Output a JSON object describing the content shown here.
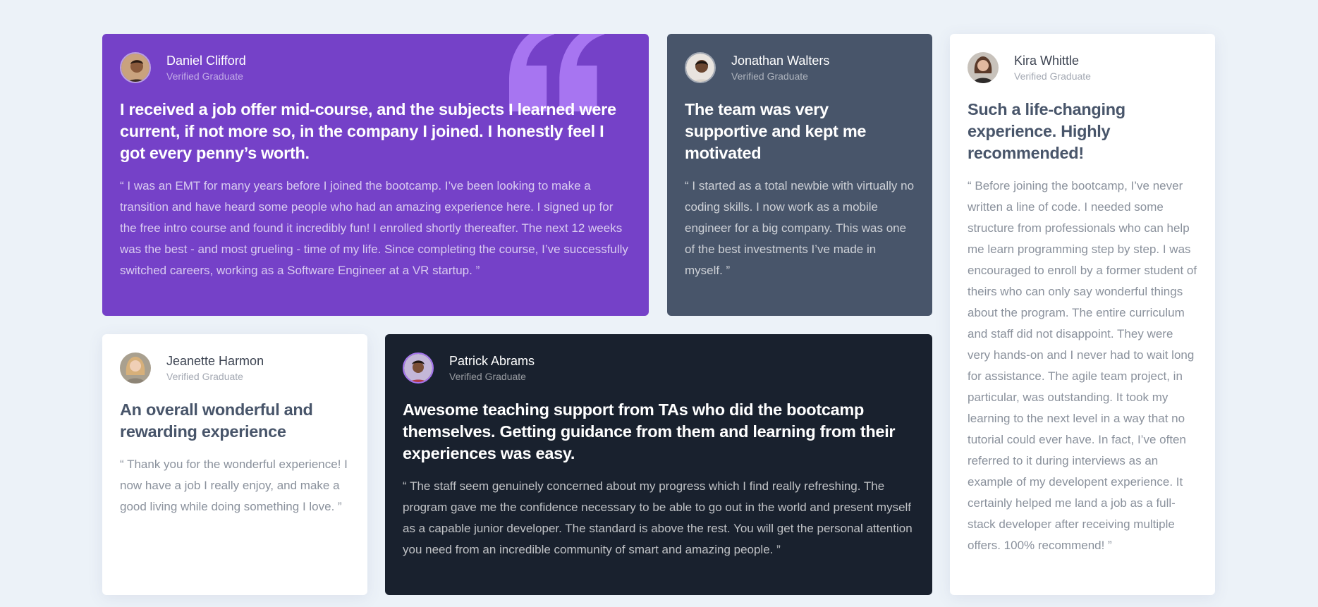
{
  "colors": {
    "page_bg": "#ecf2f8",
    "violet": "#7541c8",
    "grey_blue": "#48556a",
    "white": "#ffffff",
    "dark_navy": "#19212e",
    "quote_mark": "#a775f1"
  },
  "testimonials": [
    {
      "name": "Daniel Clifford",
      "role": "Verified Graduate",
      "headline": "I received a job offer mid-course, and the subjects I learned were current, if not more so, in the company I joined. I honestly feel I got every penny’s worth.",
      "quote": "“ I was an EMT for many years before I joined the bootcamp. I’ve been looking to make a transition and have heard some people who had an amazing experience here. I signed up for the free intro course and found it incredibly fun! I enrolled shortly thereafter. The next 12 weeks was the best - and most grueling - time of my life. Since completing the course, I’ve successfully switched careers, working as a Software Engineer at a VR startup. ”",
      "avatar_icon": "avatar-photo"
    },
    {
      "name": "Jonathan Walters",
      "role": "Verified Graduate",
      "headline": "The team was very supportive and kept me motivated",
      "quote": "“ I started as a total newbie with virtually no coding skills. I now work as a mobile engineer for a big company. This was one of the best investments I’ve made in myself. ”",
      "avatar_icon": "avatar-photo"
    },
    {
      "name": "Kira Whittle",
      "role": "Verified Graduate",
      "headline": "Such a life-changing experience. Highly recommended!",
      "quote": "“ Before joining the bootcamp, I’ve never written a line of code. I needed some structure from professionals who can help me learn programming step by step. I was encouraged to enroll by a former student of theirs who can only say wonderful things about the program. The entire curriculum and staff did not disappoint. They were very hands-on and I never had to wait long for assistance. The agile team project, in particular, was outstanding. It took my learning to the next level in a way that no tutorial could ever have. In fact, I’ve often referred to it during interviews as an example of my developent experience. It certainly helped me land a job as a full-stack developer after receiving multiple offers. 100% recommend! ”",
      "avatar_icon": "avatar-photo"
    },
    {
      "name": "Jeanette Harmon",
      "role": "Verified Graduate",
      "headline": "An overall wonderful and rewarding experience",
      "quote": "“ Thank you for the wonderful experience! I now have a job I really enjoy, and make a good living while doing something I love. ”",
      "avatar_icon": "avatar-photo"
    },
    {
      "name": "Patrick Abrams",
      "role": "Verified Graduate",
      "headline": "Awesome teaching support from TAs who did the bootcamp themselves. Getting guidance from them and learning from their experiences was easy.",
      "quote": "“ The staff seem genuinely concerned about my progress which I find really refreshing. The program gave me the confidence necessary to be able to go out in the world and present myself as a capable junior developer. The standard is above the rest. You will get the personal attention you need from an incredible community of smart and amazing people. ”",
      "avatar_icon": "avatar-photo"
    }
  ]
}
